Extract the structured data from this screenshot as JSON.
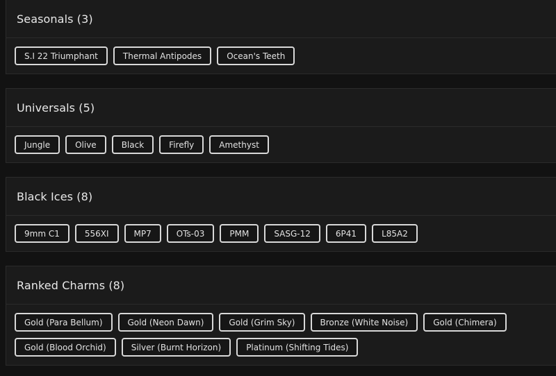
{
  "sections": [
    {
      "title": "Seasonals (3)",
      "items": [
        "S.I 22 Triumphant",
        "Thermal Antipodes",
        "Ocean's Teeth"
      ]
    },
    {
      "title": "Universals (5)",
      "items": [
        "Jungle",
        "Olive",
        "Black",
        "Firefly",
        "Amethyst"
      ]
    },
    {
      "title": "Black Ices (8)",
      "items": [
        "9mm C1",
        "556XI",
        "MP7",
        "OTs-03",
        "PMM",
        "SASG-12",
        "6P41",
        "L85A2"
      ]
    },
    {
      "title": "Ranked Charms (8)",
      "items": [
        "Gold (Para Bellum)",
        "Gold (Neon Dawn)",
        "Gold (Grim Sky)",
        "Bronze (White Noise)",
        "Gold (Chimera)",
        "Gold (Blood Orchid)",
        "Silver (Burnt Horizon)",
        "Platinum (Shifting Tides)"
      ]
    }
  ]
}
